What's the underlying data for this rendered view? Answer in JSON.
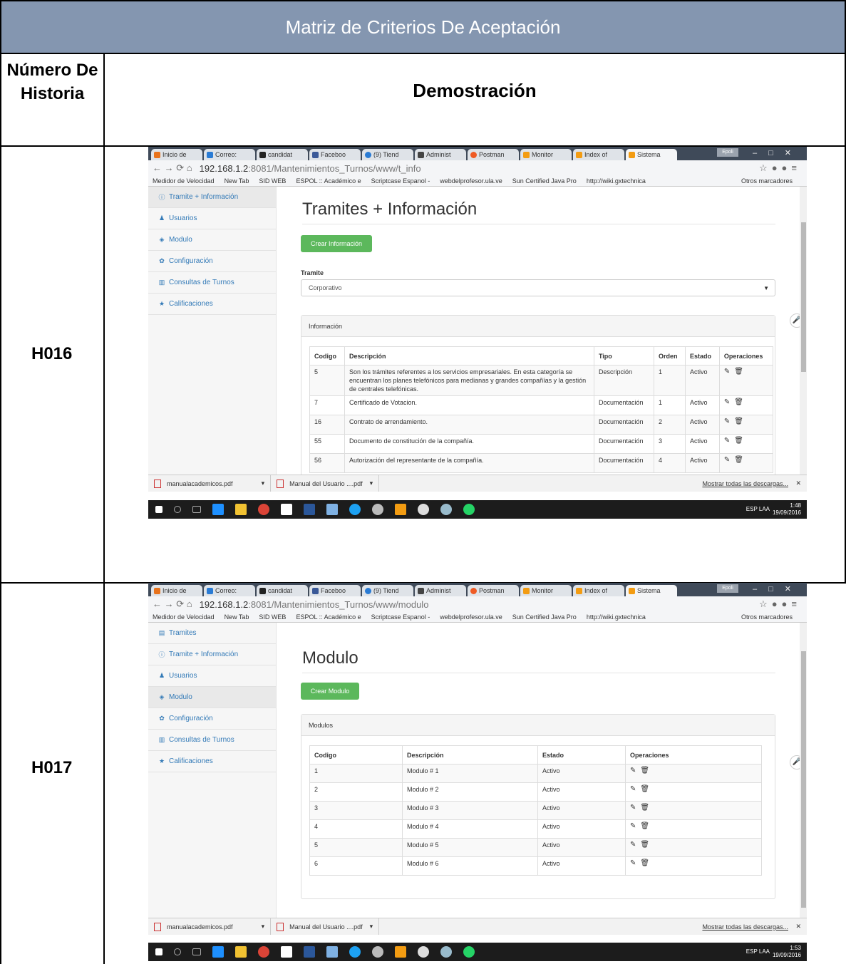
{
  "document": {
    "header_title": "Matriz de Criterios De Aceptación",
    "col1_header": "Número De Historia",
    "col2_header": "Demostración",
    "rows": [
      {
        "id": "H016"
      },
      {
        "id": "H017"
      }
    ]
  },
  "browser": {
    "tabs": [
      "Inicio de",
      "Correo:",
      "candidat",
      "Faceboo",
      "(9) Tiend",
      "Administ",
      "Postman",
      "Monitor",
      "Index of",
      "Sistema"
    ],
    "profile_badge": "Epoli",
    "bookmarks": [
      "Medidor de Velocidad",
      "New Tab",
      "SID WEB",
      "ESPOL :: Académico e",
      "Scriptcase Espanol -",
      "webdelprofesor.ula.ve",
      "Sun Certified Java Pro",
      "http://wiki.gxtechnica"
    ],
    "bookmarks_other": "Otros marcadores",
    "downloads": [
      "manualacademicos.pdf",
      "Manual del Usuario ....pdf"
    ],
    "downloads_more": "Mostrar todas las descargas...",
    "taskbar_lang": "ESP LAA"
  },
  "shot1": {
    "url_host": "192.168.1.2",
    "url_rest": ":8081/Mantenimientos_Turnos/www/t_info",
    "sidebar": [
      "Tramite + Información",
      "Usuarios",
      "Modulo",
      "Configuración",
      "Consultas de Turnos",
      "Calificaciones"
    ],
    "page_title": "Tramites + Información",
    "create_button": "Crear Información",
    "select_label": "Tramite",
    "select_value": "Corporativo",
    "panel_title": "Información",
    "columns": [
      "Codigo",
      "Descripción",
      "Tipo",
      "Orden",
      "Estado",
      "Operaciones"
    ],
    "rows": [
      {
        "codigo": "5",
        "descripcion": "Son los trámites referentes a los servicios empresariales. En esta categoría se encuentran los planes telefónicos para medianas y grandes compañías y la gestión de centrales telefónicas.",
        "tipo": "Descripción",
        "orden": "1",
        "estado": "Activo"
      },
      {
        "codigo": "7",
        "descripcion": "Certificado de Votacion.",
        "tipo": "Documentación",
        "orden": "1",
        "estado": "Activo"
      },
      {
        "codigo": "16",
        "descripcion": "Contrato de arrendamiento.",
        "tipo": "Documentación",
        "orden": "2",
        "estado": "Activo"
      },
      {
        "codigo": "55",
        "descripcion": "Documento de constitución de la compañía.",
        "tipo": "Documentación",
        "orden": "3",
        "estado": "Activo"
      },
      {
        "codigo": "56",
        "descripcion": "Autorización del representante de la compañía.",
        "tipo": "Documentación",
        "orden": "4",
        "estado": "Activo"
      }
    ],
    "time": "1:48",
    "date": "19/09/2016"
  },
  "shot2": {
    "url_host": "192.168.1.2",
    "url_rest": ":8081/Mantenimientos_Turnos/www/modulo",
    "sidebar": [
      "Tramites",
      "Tramite + Información",
      "Usuarios",
      "Modulo",
      "Configuración",
      "Consultas de Turnos",
      "Calificaciones"
    ],
    "page_title": "Modulo",
    "create_button": "Crear Modulo",
    "panel_title": "Modulos",
    "columns": [
      "Codigo",
      "Descripción",
      "Estado",
      "Operaciones"
    ],
    "rows": [
      {
        "codigo": "1",
        "descripcion": "Modulo # 1",
        "estado": "Activo"
      },
      {
        "codigo": "2",
        "descripcion": "Modulo # 2",
        "estado": "Activo"
      },
      {
        "codigo": "3",
        "descripcion": "Modulo # 3",
        "estado": "Activo"
      },
      {
        "codigo": "4",
        "descripcion": "Modulo # 4",
        "estado": "Activo"
      },
      {
        "codigo": "5",
        "descripcion": "Modulo # 5",
        "estado": "Activo"
      },
      {
        "codigo": "6",
        "descripcion": "Modulo # 6",
        "estado": "Activo"
      }
    ],
    "time": "1:53",
    "date": "19/09/2016"
  }
}
